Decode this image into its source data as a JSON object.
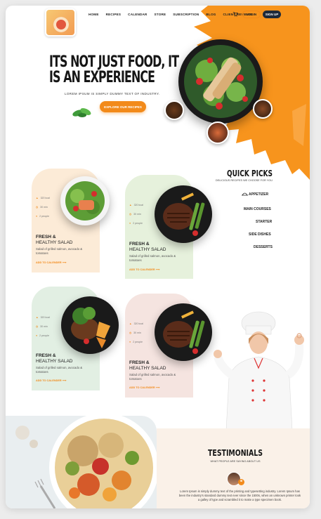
{
  "nav": {
    "items": [
      "HOME",
      "RECIPES",
      "CALENDAR",
      "STORE",
      "SUBSCRIPTION",
      "BLOG",
      "CLIENT REVIEWS"
    ],
    "login": "LOGIN",
    "signup": "SIGN UP"
  },
  "hero": {
    "title_line1": "ITS NOT JUST FOOD, IT",
    "title_line2": "IS AN EXPERIENCE",
    "subtitle": "LOREM IPSUM IS SIMPLY DUMMY TEXT OF INDUSTRY.",
    "cta": "EXPLORE OUR RECIPES"
  },
  "quick_picks": {
    "title": "QUICK PICKS",
    "subtitle": "DELICIOUS RECIPES WE CHOOSE FOR YOU",
    "items": [
      "APPETIZER",
      "MAIN COURSES",
      "STARTER",
      "SIDE DISHES",
      "DESSERTS"
    ]
  },
  "cards": [
    {
      "kcal": "320 kcal",
      "min": "30 min",
      "serves": "2 people",
      "title1": "FRESH &",
      "title2": "HEALTHY SALAD",
      "desc": "Salad of grilled salmon, avocado & tomatoes",
      "add": "ADD TO CALENDER"
    },
    {
      "kcal": "320 kcal",
      "min": "30 min",
      "serves": "2 people",
      "title1": "FRESH &",
      "title2": "HEALTHY SALAD",
      "desc": "Salad of grilled salmon, avocado & tomatoes",
      "add": "ADD TO CALENDER"
    },
    {
      "kcal": "320 kcal",
      "min": "30 min",
      "serves": "2 people",
      "title1": "FRESH &",
      "title2": "HEALTHY SALAD",
      "desc": "Salad of grilled salmon, avocado & tomatoes",
      "add": "ADD TO CALENDER"
    },
    {
      "kcal": "320 kcal",
      "min": "30 min",
      "serves": "2 people",
      "title1": "FRESH &",
      "title2": "HEALTHY SALAD",
      "desc": "Salad of grilled salmon, avocado & tomatoes",
      "add": "ADD TO CALENDER"
    }
  ],
  "testimonials": {
    "title": "TESTIMONIALS",
    "subtitle": "WHAT PEOPLE ARE SAYING ABOUT US",
    "text": "Lorem Ipsum is simply dummy text of the printing and typesetting industry. Lorem Ipsum has been the industry's standard dummy text ever since the 1500s, when an unknown printer took a galley of type and scrambled it to make a type specimen book."
  },
  "colors": {
    "accent": "#f28a1a",
    "dark": "#1e2a3a",
    "card_peach": "#fcebd7",
    "card_mint": "#e6f1dc",
    "card_sage": "#e2efe3",
    "card_blush": "#f5e4e0"
  }
}
